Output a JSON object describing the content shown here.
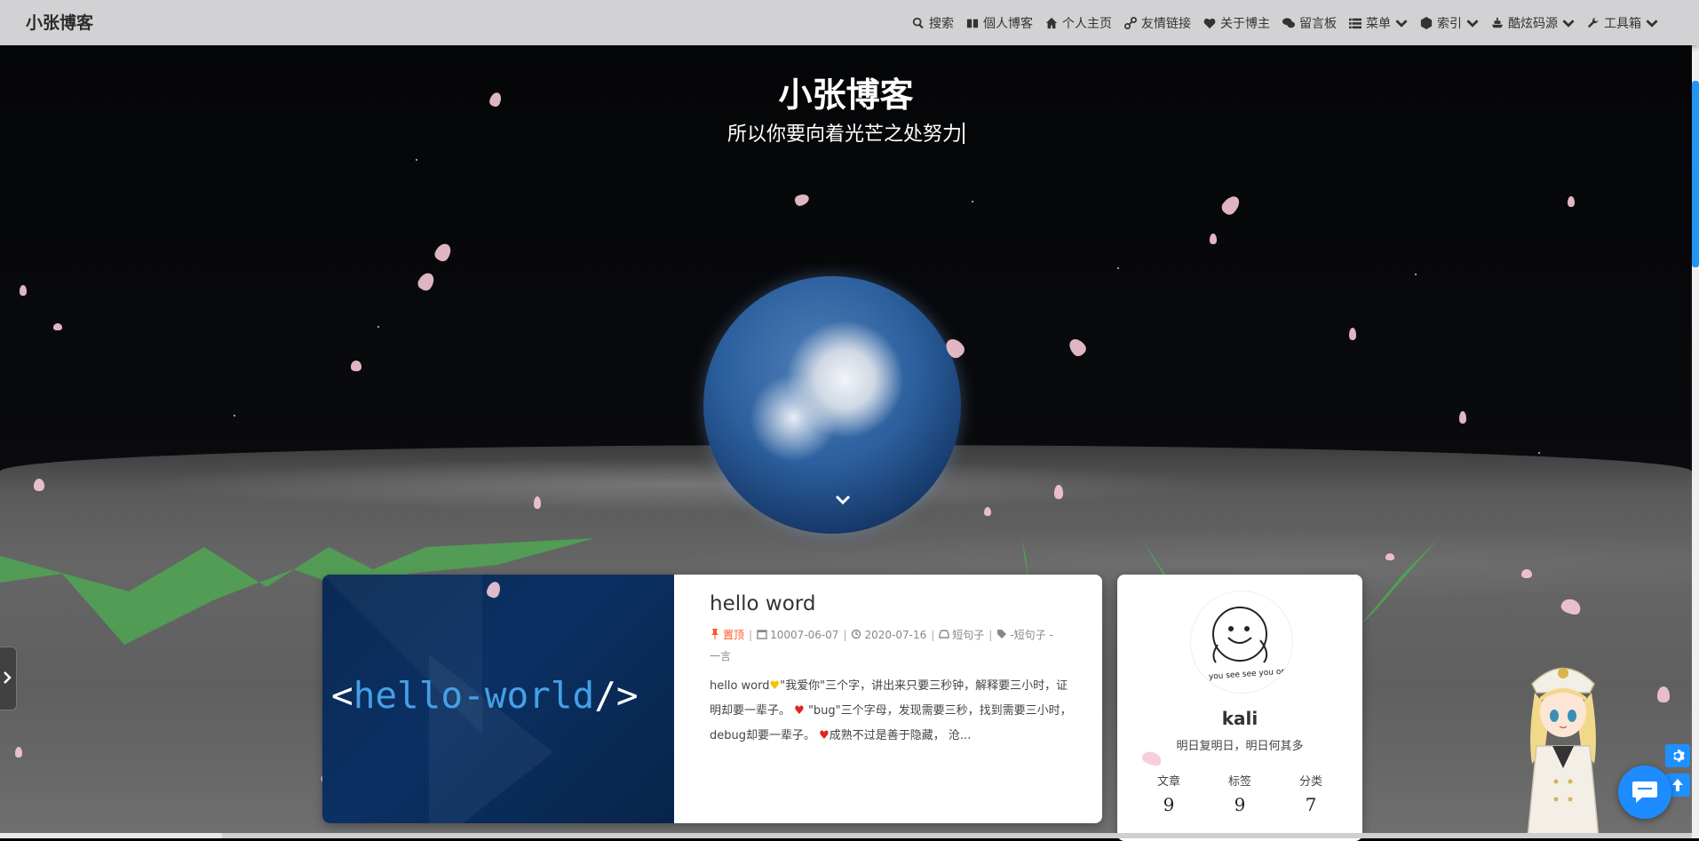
{
  "navbar": {
    "brand": "小张博客",
    "items": [
      {
        "label": "搜索",
        "icon": "search-icon"
      },
      {
        "label": "個人博客",
        "icon": "book-icon"
      },
      {
        "label": "个人主页",
        "icon": "home-icon"
      },
      {
        "label": "友情链接",
        "icon": "link-icon"
      },
      {
        "label": "关于博主",
        "icon": "heart-icon"
      },
      {
        "label": "留言板",
        "icon": "comments-icon"
      },
      {
        "label": "菜单",
        "icon": "list-icon",
        "dropdown": true
      },
      {
        "label": "索引",
        "icon": "cube-icon",
        "dropdown": true
      },
      {
        "label": "酷炫码源",
        "icon": "ship-icon",
        "dropdown": true
      },
      {
        "label": "工具箱",
        "icon": "wrench-icon",
        "dropdown": true
      }
    ]
  },
  "hero": {
    "title": "小张博客",
    "slogan": "所以你要向着光芒之处努力"
  },
  "post": {
    "cover_text_open": "<",
    "cover_text_word": "hello-world",
    "cover_text_close": "/>",
    "title": "hello word",
    "pinned_label": "置顶",
    "created": "10007-06-07",
    "updated": "2020-07-16",
    "category": "短句子",
    "tags": "-短句子 -",
    "tags_cont": "一言",
    "excerpt_1": "hello word",
    "excerpt_2": "\"我爱你\"三个字，讲出来只要三秒钟，解释要三小时，证明却要一辈子。",
    "excerpt_3": "\"bug\"三个字母，发现需要三秒，找到需要三小时，debug却要一辈子。",
    "excerpt_4": "成熟不过是善于隐藏， 沧..."
  },
  "profile": {
    "name": "kali",
    "motto": "明日复明日，明日何其多",
    "avatar_caption": "you see see you one day day",
    "stats": [
      {
        "label": "文章",
        "value": "9"
      },
      {
        "label": "标签",
        "value": "9"
      },
      {
        "label": "分类",
        "value": "7"
      }
    ]
  },
  "colors": {
    "accent": "#1e90ff",
    "pinned": "#ff5722",
    "navbar_bg": "#d2d2d4"
  }
}
